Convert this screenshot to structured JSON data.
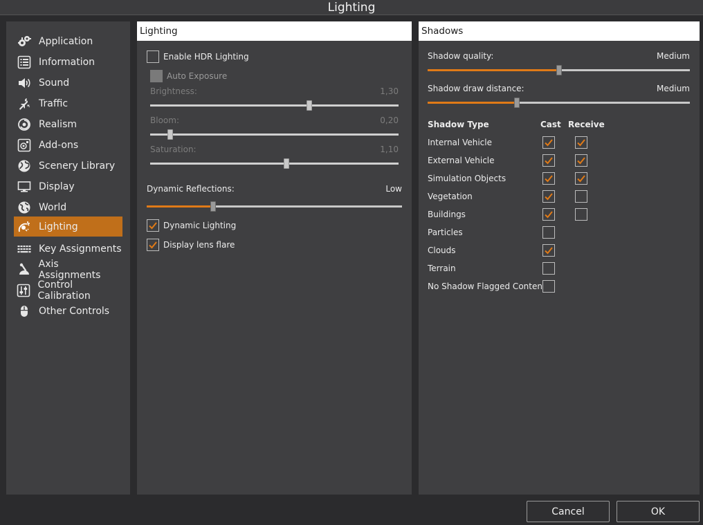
{
  "window": {
    "title": "Lighting"
  },
  "sidebar": {
    "items": [
      {
        "label": "Application",
        "icon": "gears-icon"
      },
      {
        "label": "Information",
        "icon": "list-icon"
      },
      {
        "label": "Sound",
        "icon": "speaker-icon"
      },
      {
        "label": "Traffic",
        "icon": "airplanes-icon"
      },
      {
        "label": "Realism",
        "icon": "swirl-icon"
      },
      {
        "label": "Add-ons",
        "icon": "addons-icon"
      },
      {
        "label": "Scenery Library",
        "icon": "scenery-globe-icon"
      },
      {
        "label": "Display",
        "icon": "monitor-icon"
      },
      {
        "label": "World",
        "icon": "globe-icon"
      },
      {
        "label": "Lighting",
        "icon": "lighting-icon",
        "active": true
      },
      {
        "label": "Key Assignments",
        "icon": "keyboard-icon"
      },
      {
        "label": "Axis Assignments",
        "icon": "joystick-icon"
      },
      {
        "label": "Control Calibration",
        "icon": "sliders-icon"
      },
      {
        "label": "Other Controls",
        "icon": "mouse-icon"
      }
    ]
  },
  "lighting": {
    "header": "Lighting",
    "enable_hdr": {
      "label": "Enable HDR Lighting",
      "checked": false
    },
    "auto_exposure": {
      "label": "Auto Exposure",
      "checked": false,
      "disabled": true
    },
    "brightness": {
      "label": "Brightness:",
      "value": "1,30",
      "level": 0.64
    },
    "bloom": {
      "label": "Bloom:",
      "value": "0,20",
      "level": 0.08
    },
    "saturation": {
      "label": "Saturation:",
      "value": "1,10",
      "level": 0.55
    },
    "reflections": {
      "label": "Dynamic Reflections:",
      "value": "Low",
      "level": 0.26
    },
    "dynamic_lighting": {
      "label": "Dynamic Lighting",
      "checked": true
    },
    "lens_flare": {
      "label": "Display lens flare",
      "checked": true
    }
  },
  "shadows": {
    "header": "Shadows",
    "quality": {
      "label": "Shadow quality:",
      "value": "Medium",
      "level": 0.5
    },
    "distance": {
      "label": "Shadow draw distance:",
      "value": "Medium",
      "level": 0.34
    },
    "columns": {
      "type": "Shadow Type",
      "cast": "Cast",
      "receive": "Receive"
    },
    "rows": [
      {
        "label": "Internal Vehicle",
        "cast": true,
        "receive": true
      },
      {
        "label": "External Vehicle",
        "cast": true,
        "receive": true
      },
      {
        "label": "Simulation Objects",
        "cast": true,
        "receive": true
      },
      {
        "label": "Vegetation",
        "cast": true,
        "receive": false
      },
      {
        "label": "Buildings",
        "cast": true,
        "receive": false
      },
      {
        "label": "Particles",
        "cast": false,
        "receive": null
      },
      {
        "label": "Clouds",
        "cast": true,
        "receive": null
      },
      {
        "label": "Terrain",
        "cast": false,
        "receive": null
      },
      {
        "label": "No Shadow Flagged Content",
        "cast": false,
        "receive": null
      }
    ]
  },
  "footer": {
    "cancel": "Cancel",
    "ok": "OK"
  },
  "colors": {
    "accent": "#e07a17",
    "active_item": "#c06f1a",
    "panel": "#3f3f41",
    "background": "#2b2b2d"
  }
}
